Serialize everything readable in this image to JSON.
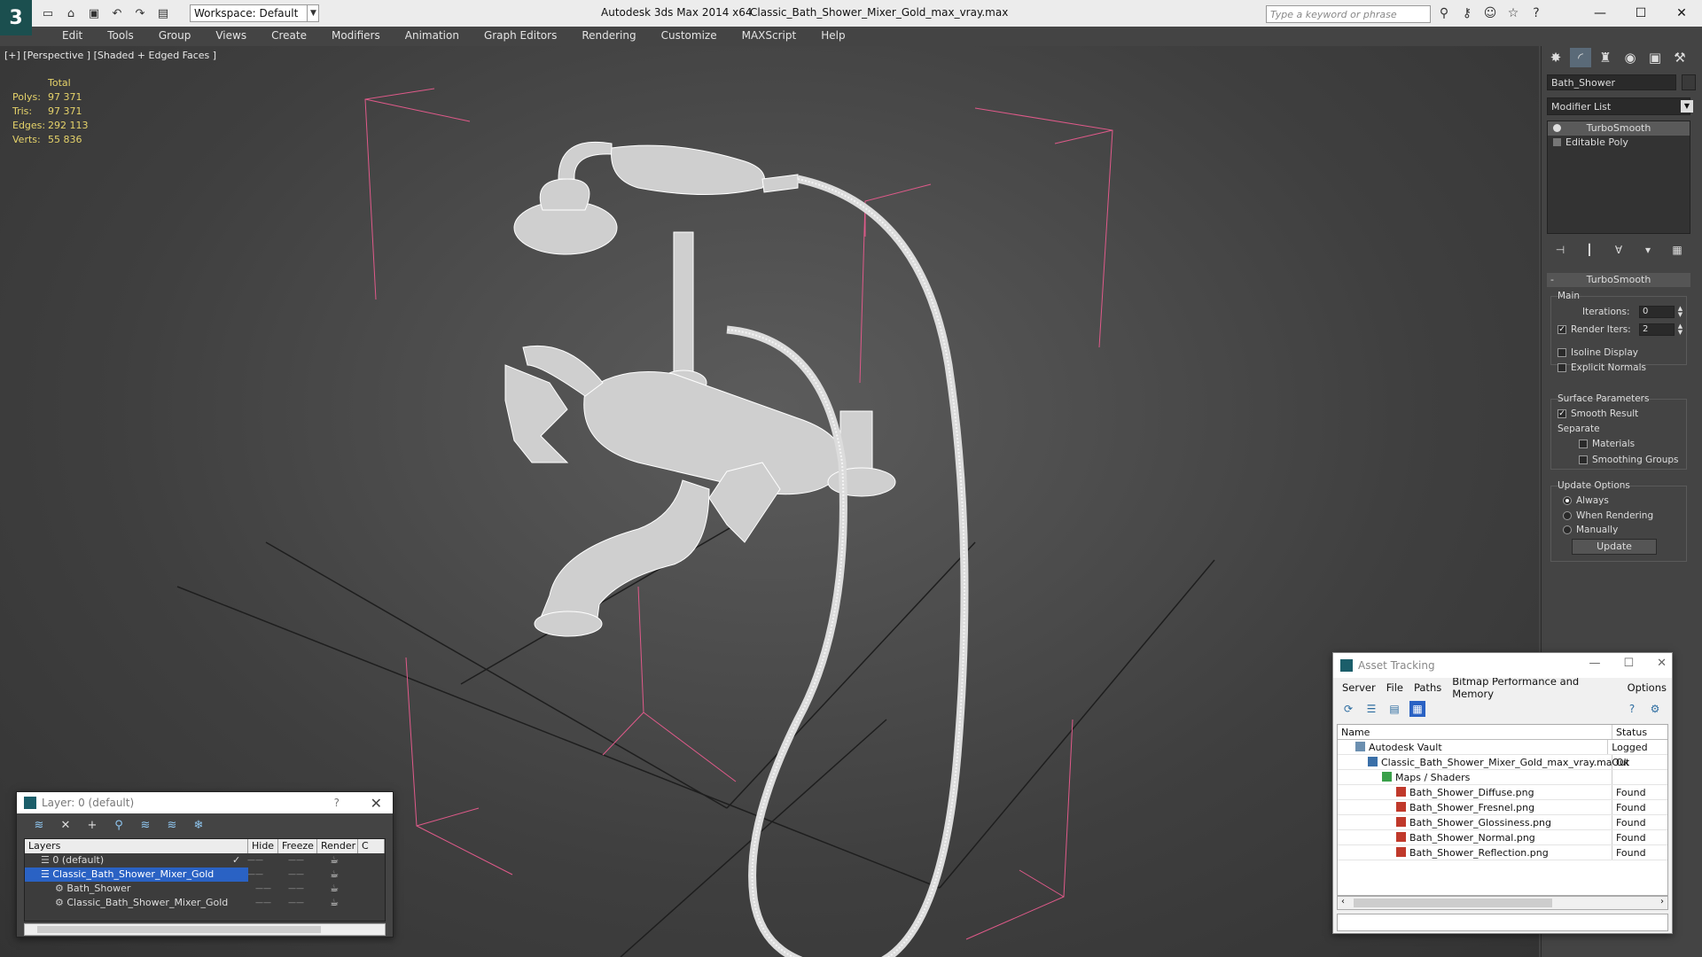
{
  "app": {
    "title": "Autodesk 3ds Max  2014 x64",
    "file": "Classic_Bath_Shower_Mixer_Gold_max_vray.max",
    "workspace": "Workspace: Default",
    "search_placeholder": "Type a keyword or phrase"
  },
  "menu": [
    "Edit",
    "Tools",
    "Group",
    "Views",
    "Create",
    "Modifiers",
    "Animation",
    "Graph Editors",
    "Rendering",
    "Customize",
    "MAXScript",
    "Help"
  ],
  "viewport": {
    "label": "[+] [Perspective ] [Shaded + Edged Faces ]",
    "stats": {
      "header": "Total",
      "rows": [
        {
          "k": "Polys:",
          "v": "97 371"
        },
        {
          "k": "Tris:",
          "v": "97 371"
        },
        {
          "k": "Edges:",
          "v": "292 113"
        },
        {
          "k": "Verts:",
          "v": "55 836"
        }
      ]
    }
  },
  "command_panel": {
    "object_name": "Bath_Shower",
    "modifier_list": "Modifier List",
    "stack": [
      "TurboSmooth",
      "Editable Poly"
    ],
    "turbosmooth": {
      "title": "TurboSmooth",
      "main": "Main",
      "iterations_label": "Iterations:",
      "iterations": "0",
      "render_iters_label": "Render Iters:",
      "render_iters": "2",
      "isoline": "Isoline Display",
      "explicit": "Explicit Normals",
      "surface": "Surface Parameters",
      "smooth": "Smooth Result",
      "separate": "Separate",
      "materials": "Materials",
      "smoothing": "Smoothing Groups",
      "update_options": "Update Options",
      "always": "Always",
      "when_rendering": "When Rendering",
      "manually": "Manually",
      "update": "Update"
    }
  },
  "layer_window": {
    "title": "Layer: 0 (default)",
    "help": "?",
    "columns": [
      "Layers",
      "Hide",
      "Freeze",
      "Render",
      "C"
    ],
    "rows": [
      {
        "name": "0 (default)",
        "indent": 1
      },
      {
        "name": "Classic_Bath_Shower_Mixer_Gold",
        "indent": 1
      },
      {
        "name": "Bath_Shower",
        "indent": 2
      },
      {
        "name": "Classic_Bath_Shower_Mixer_Gold",
        "indent": 2
      }
    ]
  },
  "asset_tracking": {
    "title": "Asset Tracking",
    "menu": [
      "Server",
      "File",
      "Paths",
      "Bitmap Performance and Memory",
      "Options"
    ],
    "columns": [
      "Name",
      "Status"
    ],
    "rows": [
      {
        "name": "Autodesk Vault",
        "status": "Logged Out",
        "indent": 1,
        "icon": "vault-icon"
      },
      {
        "name": "Classic_Bath_Shower_Mixer_Gold_max_vray.max",
        "status": "Ok",
        "indent": 2,
        "icon": "max-file-icon"
      },
      {
        "name": "Maps / Shaders",
        "status": "",
        "indent": 3,
        "icon": "maps-folder-icon"
      },
      {
        "name": "Bath_Shower_Diffuse.png",
        "status": "Found",
        "indent": 4,
        "icon": "png-file-icon"
      },
      {
        "name": "Bath_Shower_Fresnel.png",
        "status": "Found",
        "indent": 4,
        "icon": "png-file-icon"
      },
      {
        "name": "Bath_Shower_Glossiness.png",
        "status": "Found",
        "indent": 4,
        "icon": "png-file-icon"
      },
      {
        "name": "Bath_Shower_Normal.png",
        "status": "Found",
        "indent": 4,
        "icon": "png-file-icon"
      },
      {
        "name": "Bath_Shower_Reflection.png",
        "status": "Found",
        "indent": 4,
        "icon": "png-file-icon"
      }
    ]
  }
}
